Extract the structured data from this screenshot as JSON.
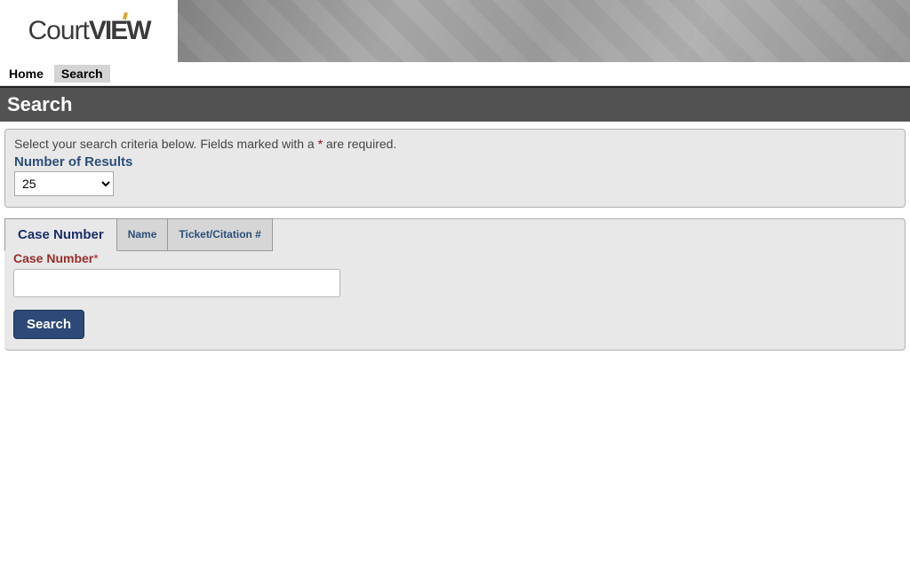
{
  "brand": {
    "part1": "Court",
    "part2": "VIEW"
  },
  "nav": {
    "home": "Home",
    "search": "Search"
  },
  "page": {
    "title": "Search"
  },
  "criteria": {
    "instructions_prefix": "Select your search criteria below. Fields marked with a ",
    "asterisk": "*",
    "instructions_suffix": " are required.",
    "results_label": "Number of Results",
    "results_options": [
      "25"
    ],
    "results_selected": "25"
  },
  "tabs": {
    "case_number": "Case Number",
    "name": "Name",
    "ticket": "Ticket/Citation #"
  },
  "form": {
    "case_number_label": "Case Number",
    "required_mark": "*",
    "case_number_value": "",
    "search_button": "Search"
  }
}
